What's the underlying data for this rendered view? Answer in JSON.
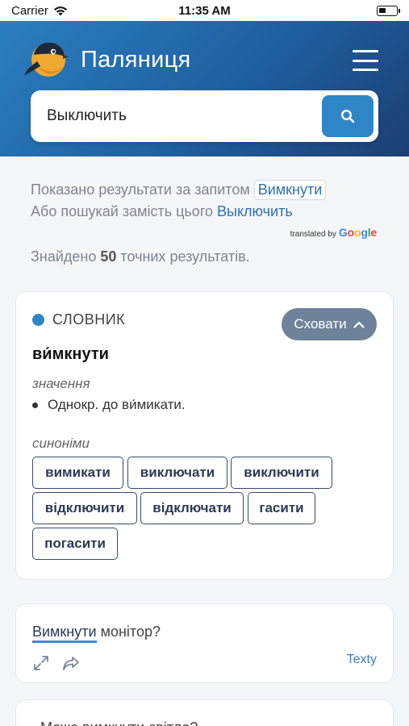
{
  "status_bar": {
    "carrier": "Carrier",
    "time": "11:35 AM",
    "battery_level": 0.4
  },
  "header": {
    "app_title": "Паляниця",
    "logo_icon": "bird-logo-icon",
    "menu_icon": "hamburger-menu-icon"
  },
  "search": {
    "value": "Выключить",
    "button_icon": "search-icon"
  },
  "results_info": {
    "shown_prefix": "Показано результати за запитом",
    "shown_query": "Вимкнути",
    "instead_prefix": "Або пошукай замість цього",
    "instead_query": "Выключить",
    "translated_by": "translated by",
    "translator": "Google",
    "found_prefix": "Знайдено",
    "found_count": "50",
    "found_suffix": "точних результатів."
  },
  "dictionary": {
    "section_title": "СЛОВНИК",
    "hide_label": "Сховати",
    "headword": "ви́мкнути",
    "meaning_label": "значення",
    "meaning": "Однокр. до ви́микати.",
    "synonyms_label": "синоніми",
    "synonyms": [
      "вимикати",
      "виключати",
      "виключити",
      "відключити",
      "відключати",
      "гасити",
      "погасити"
    ]
  },
  "examples": [
    {
      "highlight": "Вимкнути",
      "rest": "монітор?",
      "source": "Texty"
    },
    {
      "highlight": "",
      "rest": "Може вимкнути світло?",
      "source": ""
    }
  ],
  "colors": {
    "accent": "#2f86c6",
    "header_dark": "#1c3f73",
    "hide_button": "#6e8399"
  }
}
